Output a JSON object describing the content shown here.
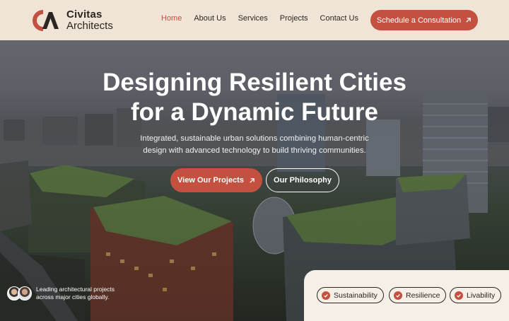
{
  "brand": {
    "name_line1": "Civitas",
    "name_line2": "Architects",
    "accent_color": "#c4503f"
  },
  "nav": {
    "items": [
      {
        "label": "Home",
        "active": true
      },
      {
        "label": "About Us",
        "active": false
      },
      {
        "label": "Services",
        "active": false
      },
      {
        "label": "Projects",
        "active": false
      },
      {
        "label": "Contact Us",
        "active": false
      }
    ]
  },
  "header_cta": {
    "label": "Schedule a Consultation",
    "icon": "arrow-up-right-icon"
  },
  "hero": {
    "title_line1": "Designing Resilient Cities",
    "title_line2": "for a Dynamic Future",
    "subtitle_line1": "Integrated, sustainable urban solutions combining human-centric",
    "subtitle_line2": "design with advanced technology to build thriving communities.",
    "primary_button": "View Our Projects",
    "secondary_button": "Our Philosophy"
  },
  "testimonial": {
    "line1": "Leading architectural projects",
    "line2": "across major cities globally."
  },
  "tags": [
    {
      "label": "Sustainability",
      "icon": "check-icon"
    },
    {
      "label": "Resilience",
      "icon": "check-icon"
    },
    {
      "label": "Livability",
      "icon": "check-icon"
    }
  ]
}
